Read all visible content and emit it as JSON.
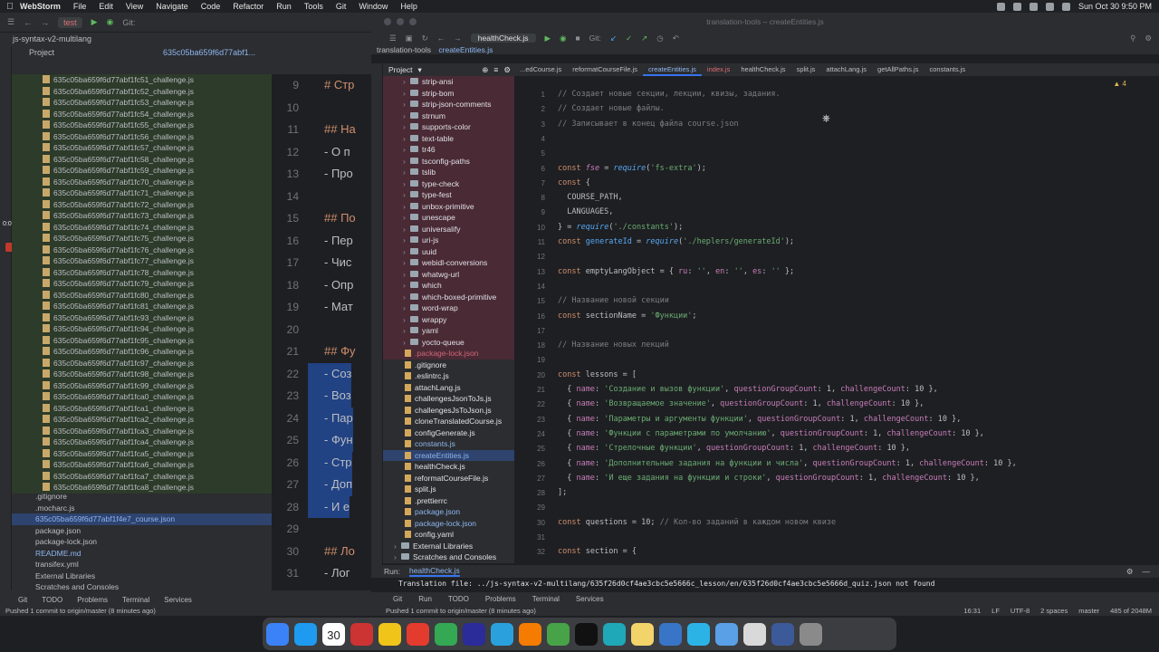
{
  "menubar": {
    "app": "WebStorm",
    "items": [
      "File",
      "Edit",
      "View",
      "Navigate",
      "Code",
      "Refactor",
      "Run",
      "Tools",
      "Git",
      "Window",
      "Help"
    ],
    "clock": "Sun Oct 30  9:50 PM"
  },
  "back_window": {
    "run_config": "test",
    "git_label": "Git:",
    "project_crumb": "js-syntax-v2-multilang",
    "project_label": "Project",
    "tab_label": "635c05ba659f6d77abf1...",
    "timer": "0:00",
    "files": [
      "635c05ba659f6d77abf1fc51_challenge.js",
      "635c05ba659f6d77abf1fc52_challenge.js",
      "635c05ba659f6d77abf1fc53_challenge.js",
      "635c05ba659f6d77abf1fc54_challenge.js",
      "635c05ba659f6d77abf1fc55_challenge.js",
      "635c05ba659f6d77abf1fc56_challenge.js",
      "635c05ba659f6d77abf1fc57_challenge.js",
      "635c05ba659f6d77abf1fc58_challenge.js",
      "635c05ba659f6d77abf1fc59_challenge.js",
      "635c05ba659f6d77abf1fc70_challenge.js",
      "635c05ba659f6d77abf1fc71_challenge.js",
      "635c05ba659f6d77abf1fc72_challenge.js",
      "635c05ba659f6d77abf1fc73_challenge.js",
      "635c05ba659f6d77abf1fc74_challenge.js",
      "635c05ba659f6d77abf1fc75_challenge.js",
      "635c05ba659f6d77abf1fc76_challenge.js",
      "635c05ba659f6d77abf1fc77_challenge.js",
      "635c05ba659f6d77abf1fc78_challenge.js",
      "635c05ba659f6d77abf1fc79_challenge.js",
      "635c05ba659f6d77abf1fc80_challenge.js",
      "635c05ba659f6d77abf1fc81_challenge.js",
      "635c05ba659f6d77abf1fc93_challenge.js",
      "635c05ba659f6d77abf1fc94_challenge.js",
      "635c05ba659f6d77abf1fc95_challenge.js",
      "635c05ba659f6d77abf1fc96_challenge.js",
      "635c05ba659f6d77abf1fc97_challenge.js",
      "635c05ba659f6d77abf1fc98_challenge.js",
      "635c05ba659f6d77abf1fc99_challenge.js",
      "635c05ba659f6d77abf1fca0_challenge.js",
      "635c05ba659f6d77abf1fca1_challenge.js",
      "635c05ba659f6d77abf1fca2_challenge.js",
      "635c05ba659f6d77abf1fca3_challenge.js",
      "635c05ba659f6d77abf1fca4_challenge.js",
      "635c05ba659f6d77abf1fca5_challenge.js",
      "635c05ba659f6d77abf1fca6_challenge.js",
      "635c05ba659f6d77abf1fca7_challenge.js",
      "635c05ba659f6d77abf1fca8_challenge.js"
    ],
    "files2": [
      {
        "name": ".gitignore",
        "cls": ""
      },
      {
        "name": ".mocharc.js",
        "cls": ""
      },
      {
        "name": "635c05ba659f6d77abf1f4e7_course.json",
        "cls": "sel"
      },
      {
        "name": "package.json",
        "cls": ""
      },
      {
        "name": "package-lock.json",
        "cls": ""
      },
      {
        "name": "README.md",
        "cls": "blue"
      },
      {
        "name": "transifex.yml",
        "cls": ""
      },
      {
        "name": "External Libraries",
        "cls": ""
      },
      {
        "name": "Scratches and Consoles",
        "cls": ""
      }
    ],
    "editor_lines": [
      {
        "n": "9",
        "t": "# Стр",
        "cls": "h"
      },
      {
        "n": "10",
        "t": "",
        "cls": ""
      },
      {
        "n": "11",
        "t": "## На",
        "cls": "h"
      },
      {
        "n": "12",
        "t": "- О п",
        "cls": ""
      },
      {
        "n": "13",
        "t": "- Про",
        "cls": ""
      },
      {
        "n": "14",
        "t": "",
        "cls": ""
      },
      {
        "n": "15",
        "t": "## По",
        "cls": "h"
      },
      {
        "n": "16",
        "t": "- Пер",
        "cls": ""
      },
      {
        "n": "17",
        "t": "- Чис",
        "cls": ""
      },
      {
        "n": "18",
        "t": "- Опр",
        "cls": ""
      },
      {
        "n": "19",
        "t": "- Мат",
        "cls": ""
      },
      {
        "n": "20",
        "t": "",
        "cls": ""
      },
      {
        "n": "21",
        "t": "## Фу",
        "cls": "h"
      },
      {
        "n": "22",
        "t": "- Соз",
        "cls": "hl"
      },
      {
        "n": "23",
        "t": "- Воз",
        "cls": "hl"
      },
      {
        "n": "24",
        "t": "- Пар",
        "cls": "hl"
      },
      {
        "n": "25",
        "t": "- Фун",
        "cls": "hl"
      },
      {
        "n": "26",
        "t": "- Стр",
        "cls": "hl"
      },
      {
        "n": "27",
        "t": "- Доп",
        "cls": "hl"
      },
      {
        "n": "28",
        "t": "- И е",
        "cls": "hl"
      },
      {
        "n": "29",
        "t": "",
        "cls": ""
      },
      {
        "n": "30",
        "t": "## Ло",
        "cls": "h"
      },
      {
        "n": "31",
        "t": "- Лог",
        "cls": ""
      },
      {
        "n": "32",
        "t": "- Сра",
        "cls": ""
      },
      {
        "n": "33",
        "t": "- Вет",
        "cls": ""
      },
      {
        "n": "34",
        "t": "- Опе",
        "cls": ""
      }
    ],
    "bottom_tabs": [
      "Git",
      "TODO",
      "Problems",
      "Terminal",
      "Services"
    ],
    "status": "Pushed 1 commit to origin/master (8 minutes ago)"
  },
  "front_window": {
    "title": "translation-tools – createEntities.js",
    "run_config": "healthCheck.js",
    "git_label": "Git:",
    "crumb_project": "translation-tools",
    "crumb_file": "createEntities.js",
    "project_label": "Project",
    "tabs": [
      {
        "label": "...edCourse.js",
        "cls": ""
      },
      {
        "label": "reformatCourseFile.js",
        "cls": ""
      },
      {
        "label": "createEntities.js",
        "cls": "act"
      },
      {
        "label": "index.js",
        "cls": "idx"
      },
      {
        "label": "healthCheck.js",
        "cls": ""
      },
      {
        "label": "split.js",
        "cls": ""
      },
      {
        "label": "attachLang.js",
        "cls": ""
      },
      {
        "label": "getAllPaths.js",
        "cls": ""
      },
      {
        "label": "constants.js",
        "cls": ""
      }
    ],
    "tree": [
      {
        "name": "strip-ansi",
        "kind": "dir",
        "cls": "red"
      },
      {
        "name": "strip-bom",
        "kind": "dir",
        "cls": "red"
      },
      {
        "name": "strip-json-comments",
        "kind": "dir",
        "cls": "red"
      },
      {
        "name": "strnum",
        "kind": "dir",
        "cls": "red"
      },
      {
        "name": "supports-color",
        "kind": "dir",
        "cls": "red"
      },
      {
        "name": "text-table",
        "kind": "dir",
        "cls": "red"
      },
      {
        "name": "tr46",
        "kind": "dir",
        "cls": "red"
      },
      {
        "name": "tsconfig-paths",
        "kind": "dir",
        "cls": "red"
      },
      {
        "name": "tslib",
        "kind": "dir",
        "cls": "red"
      },
      {
        "name": "type-check",
        "kind": "dir",
        "cls": "red"
      },
      {
        "name": "type-fest",
        "kind": "dir",
        "cls": "red"
      },
      {
        "name": "unbox-primitive",
        "kind": "dir",
        "cls": "red"
      },
      {
        "name": "unescape",
        "kind": "dir",
        "cls": "red"
      },
      {
        "name": "universalify",
        "kind": "dir",
        "cls": "red"
      },
      {
        "name": "uri-js",
        "kind": "dir",
        "cls": "red"
      },
      {
        "name": "uuid",
        "kind": "dir",
        "cls": "red"
      },
      {
        "name": "webidl-conversions",
        "kind": "dir",
        "cls": "red"
      },
      {
        "name": "whatwg-url",
        "kind": "dir",
        "cls": "red"
      },
      {
        "name": "which",
        "kind": "dir",
        "cls": "red"
      },
      {
        "name": "which-boxed-primitive",
        "kind": "dir",
        "cls": "red"
      },
      {
        "name": "word-wrap",
        "kind": "dir",
        "cls": "red"
      },
      {
        "name": "wrappy",
        "kind": "dir",
        "cls": "red"
      },
      {
        "name": "yaml",
        "kind": "dir",
        "cls": "red"
      },
      {
        "name": "yocto-queue",
        "kind": "dir",
        "cls": "red"
      },
      {
        "name": ".package-lock.json",
        "kind": "file",
        "cls": "pink"
      },
      {
        "name": ".gitignore",
        "kind": "file",
        "cls": ""
      },
      {
        "name": ".eslintrc.js",
        "kind": "file",
        "cls": ""
      },
      {
        "name": "attachLang.js",
        "kind": "file",
        "cls": ""
      },
      {
        "name": "challengesJsonToJs.js",
        "kind": "file",
        "cls": ""
      },
      {
        "name": "challengesJsToJson.js",
        "kind": "file",
        "cls": ""
      },
      {
        "name": "cloneTranslatedCourse.js",
        "kind": "file",
        "cls": ""
      },
      {
        "name": "configGenerate.js",
        "kind": "file",
        "cls": ""
      },
      {
        "name": "constants.js",
        "kind": "file",
        "cls": "blue"
      },
      {
        "name": "createEntities.js",
        "kind": "file",
        "cls": "sel"
      },
      {
        "name": "healthCheck.js",
        "kind": "file",
        "cls": ""
      },
      {
        "name": "reformatCourseFile.js",
        "kind": "file",
        "cls": ""
      },
      {
        "name": "split.js",
        "kind": "file",
        "cls": ""
      },
      {
        "name": ".prettierrc",
        "kind": "file",
        "cls": ""
      },
      {
        "name": "package.json",
        "kind": "file",
        "cls": "blue"
      },
      {
        "name": "package-lock.json",
        "kind": "file",
        "cls": "blue"
      },
      {
        "name": "config.yaml",
        "kind": "file",
        "cls": ""
      },
      {
        "name": "External Libraries",
        "kind": "dir",
        "cls": ""
      },
      {
        "name": "Scratches and Consoles",
        "kind": "dir",
        "cls": ""
      }
    ],
    "code": [
      {
        "n": "1",
        "html": "<span class=\"cm\">// Создает новые секции, лекции, квизы, задания.</span>"
      },
      {
        "n": "2",
        "html": "<span class=\"cm\">// Создает новые файлы.</span>"
      },
      {
        "n": "3",
        "html": "<span class=\"cm\">// Записывает в конец файла course.json</span>"
      },
      {
        "n": "4",
        "html": ""
      },
      {
        "n": "5",
        "html": ""
      },
      {
        "n": "6",
        "html": "<span class=\"kw\">const</span> <span class=\"pr it\">fse</span> = <span class=\"fn it\">require</span>(<span class=\"st\">'fs-extra'</span>);"
      },
      {
        "n": "7",
        "html": "<span class=\"kw\">const</span> {"
      },
      {
        "n": "8",
        "html": "  COURSE_PATH,"
      },
      {
        "n": "9",
        "html": "  LANGUAGES,"
      },
      {
        "n": "10",
        "html": "} = <span class=\"fn it\">require</span>(<span class=\"st\">'./constants'</span>);"
      },
      {
        "n": "11",
        "html": "<span class=\"kw\">const</span> <span class=\"fn\">generateId</span> = <span class=\"fn it\">require</span>(<span class=\"st\">'./heplers/generateId'</span>);"
      },
      {
        "n": "12",
        "html": ""
      },
      {
        "n": "13",
        "html": "<span class=\"kw\">const</span> emptyLangObject = { <span class=\"pr\">ru</span>: <span class=\"st\">''</span>, <span class=\"pr\">en</span>: <span class=\"st\">''</span>, <span class=\"pr\">es</span>: <span class=\"st\">''</span> };"
      },
      {
        "n": "14",
        "html": ""
      },
      {
        "n": "15",
        "html": "<span class=\"cm\">// Название новой секции</span>"
      },
      {
        "n": "16",
        "html": "<span class=\"kw\">const</span> sectionName = <span class=\"st\">'Функции'</span>;"
      },
      {
        "n": "17",
        "html": ""
      },
      {
        "n": "18",
        "html": "<span class=\"cm\">// Название новых лекций</span>"
      },
      {
        "n": "19",
        "html": ""
      },
      {
        "n": "20",
        "html": "<span class=\"kw\">const</span> lessons = ["
      },
      {
        "n": "21",
        "html": "  { <span class=\"pr\">name</span>: <span class=\"st\">'Создание и вызов функции'</span>, <span class=\"pr\">questionGroupCount</span>: 1, <span class=\"pr\">challengeCount</span>: 10 },"
      },
      {
        "n": "22",
        "html": "  { <span class=\"pr\">name</span>: <span class=\"st\">'Возвращаемое значение'</span>, <span class=\"pr\">questionGroupCount</span>: 1, <span class=\"pr\">challengeCount</span>: 10 },"
      },
      {
        "n": "23",
        "html": "  { <span class=\"pr\">name</span>: <span class=\"st\">'Параметры и аргументы функции'</span>, <span class=\"pr\">questionGroupCount</span>: 1, <span class=\"pr\">challengeCount</span>: 10 },"
      },
      {
        "n": "24",
        "html": "  { <span class=\"pr\">name</span>: <span class=\"st\">'Функции с параметрами по умолчанию'</span>, <span class=\"pr\">questionGroupCount</span>: 1, <span class=\"pr\">challengeCount</span>: 10 },"
      },
      {
        "n": "25",
        "html": "  { <span class=\"pr\">name</span>: <span class=\"st\">'Стрелочные функции'</span>, <span class=\"pr\">questionGroupCount</span>: 1, <span class=\"pr\">challengeCount</span>: 10 },"
      },
      {
        "n": "26",
        "html": "  { <span class=\"pr\">name</span>: <span class=\"st\">'Дополнительные задания на функции и числа'</span>, <span class=\"pr\">questionGroupCount</span>: 1, <span class=\"pr\">challengeCount</span>: 10 },"
      },
      {
        "n": "27",
        "html": "  { <span class=\"pr\">name</span>: <span class=\"st\">'И еще задания на функции и строки'</span>, <span class=\"pr\">questionGroupCount</span>: 1, <span class=\"pr\">challengeCount</span>: 10 },"
      },
      {
        "n": "28",
        "html": "];"
      },
      {
        "n": "29",
        "html": ""
      },
      {
        "n": "30",
        "html": "<span class=\"kw\">const</span> questions = 10; <span class=\"cm\">// Кол-во заданий в каждом новом квизе</span>"
      },
      {
        "n": "31",
        "html": ""
      },
      {
        "n": "32",
        "html": "<span class=\"kw\">const</span> section = {"
      }
    ],
    "run_label": "Run:",
    "run_tab": "healthCheck.js",
    "run_output": "Translation file: ../js-syntax-v2-multilang/635f26d0cf4ae3cbc5e5666c_lesson/en/635f26d0cf4ae3cbc5e5666d_quiz.json not found",
    "bottom_tabs": [
      "Git",
      "Run",
      "TODO",
      "Problems",
      "Terminal",
      "Services"
    ],
    "status": "Pushed 1 commit to origin/master (8 minutes ago)",
    "status_right": [
      "16:31",
      "LF",
      "UTF-8",
      "2 spaces",
      "master",
      "485 of 2048M"
    ],
    "warning_count": "4"
  },
  "dock": {
    "date": "30",
    "colors": [
      "#3b82f6",
      "#1e9bf0",
      "#7a7a7a",
      "#cc3333",
      "#f0c419",
      "#e33b2e",
      "#34a853",
      "#2b2b9a",
      "#2aa1dd",
      "#f57c00",
      "#47a248",
      "#111111",
      "#1fa8b8",
      "#f3d46b",
      "#3975c6",
      "#2bb3e6",
      "#5aa0e6",
      "#d9d9d9",
      "#3c5a99",
      "#8a8a8a"
    ]
  }
}
